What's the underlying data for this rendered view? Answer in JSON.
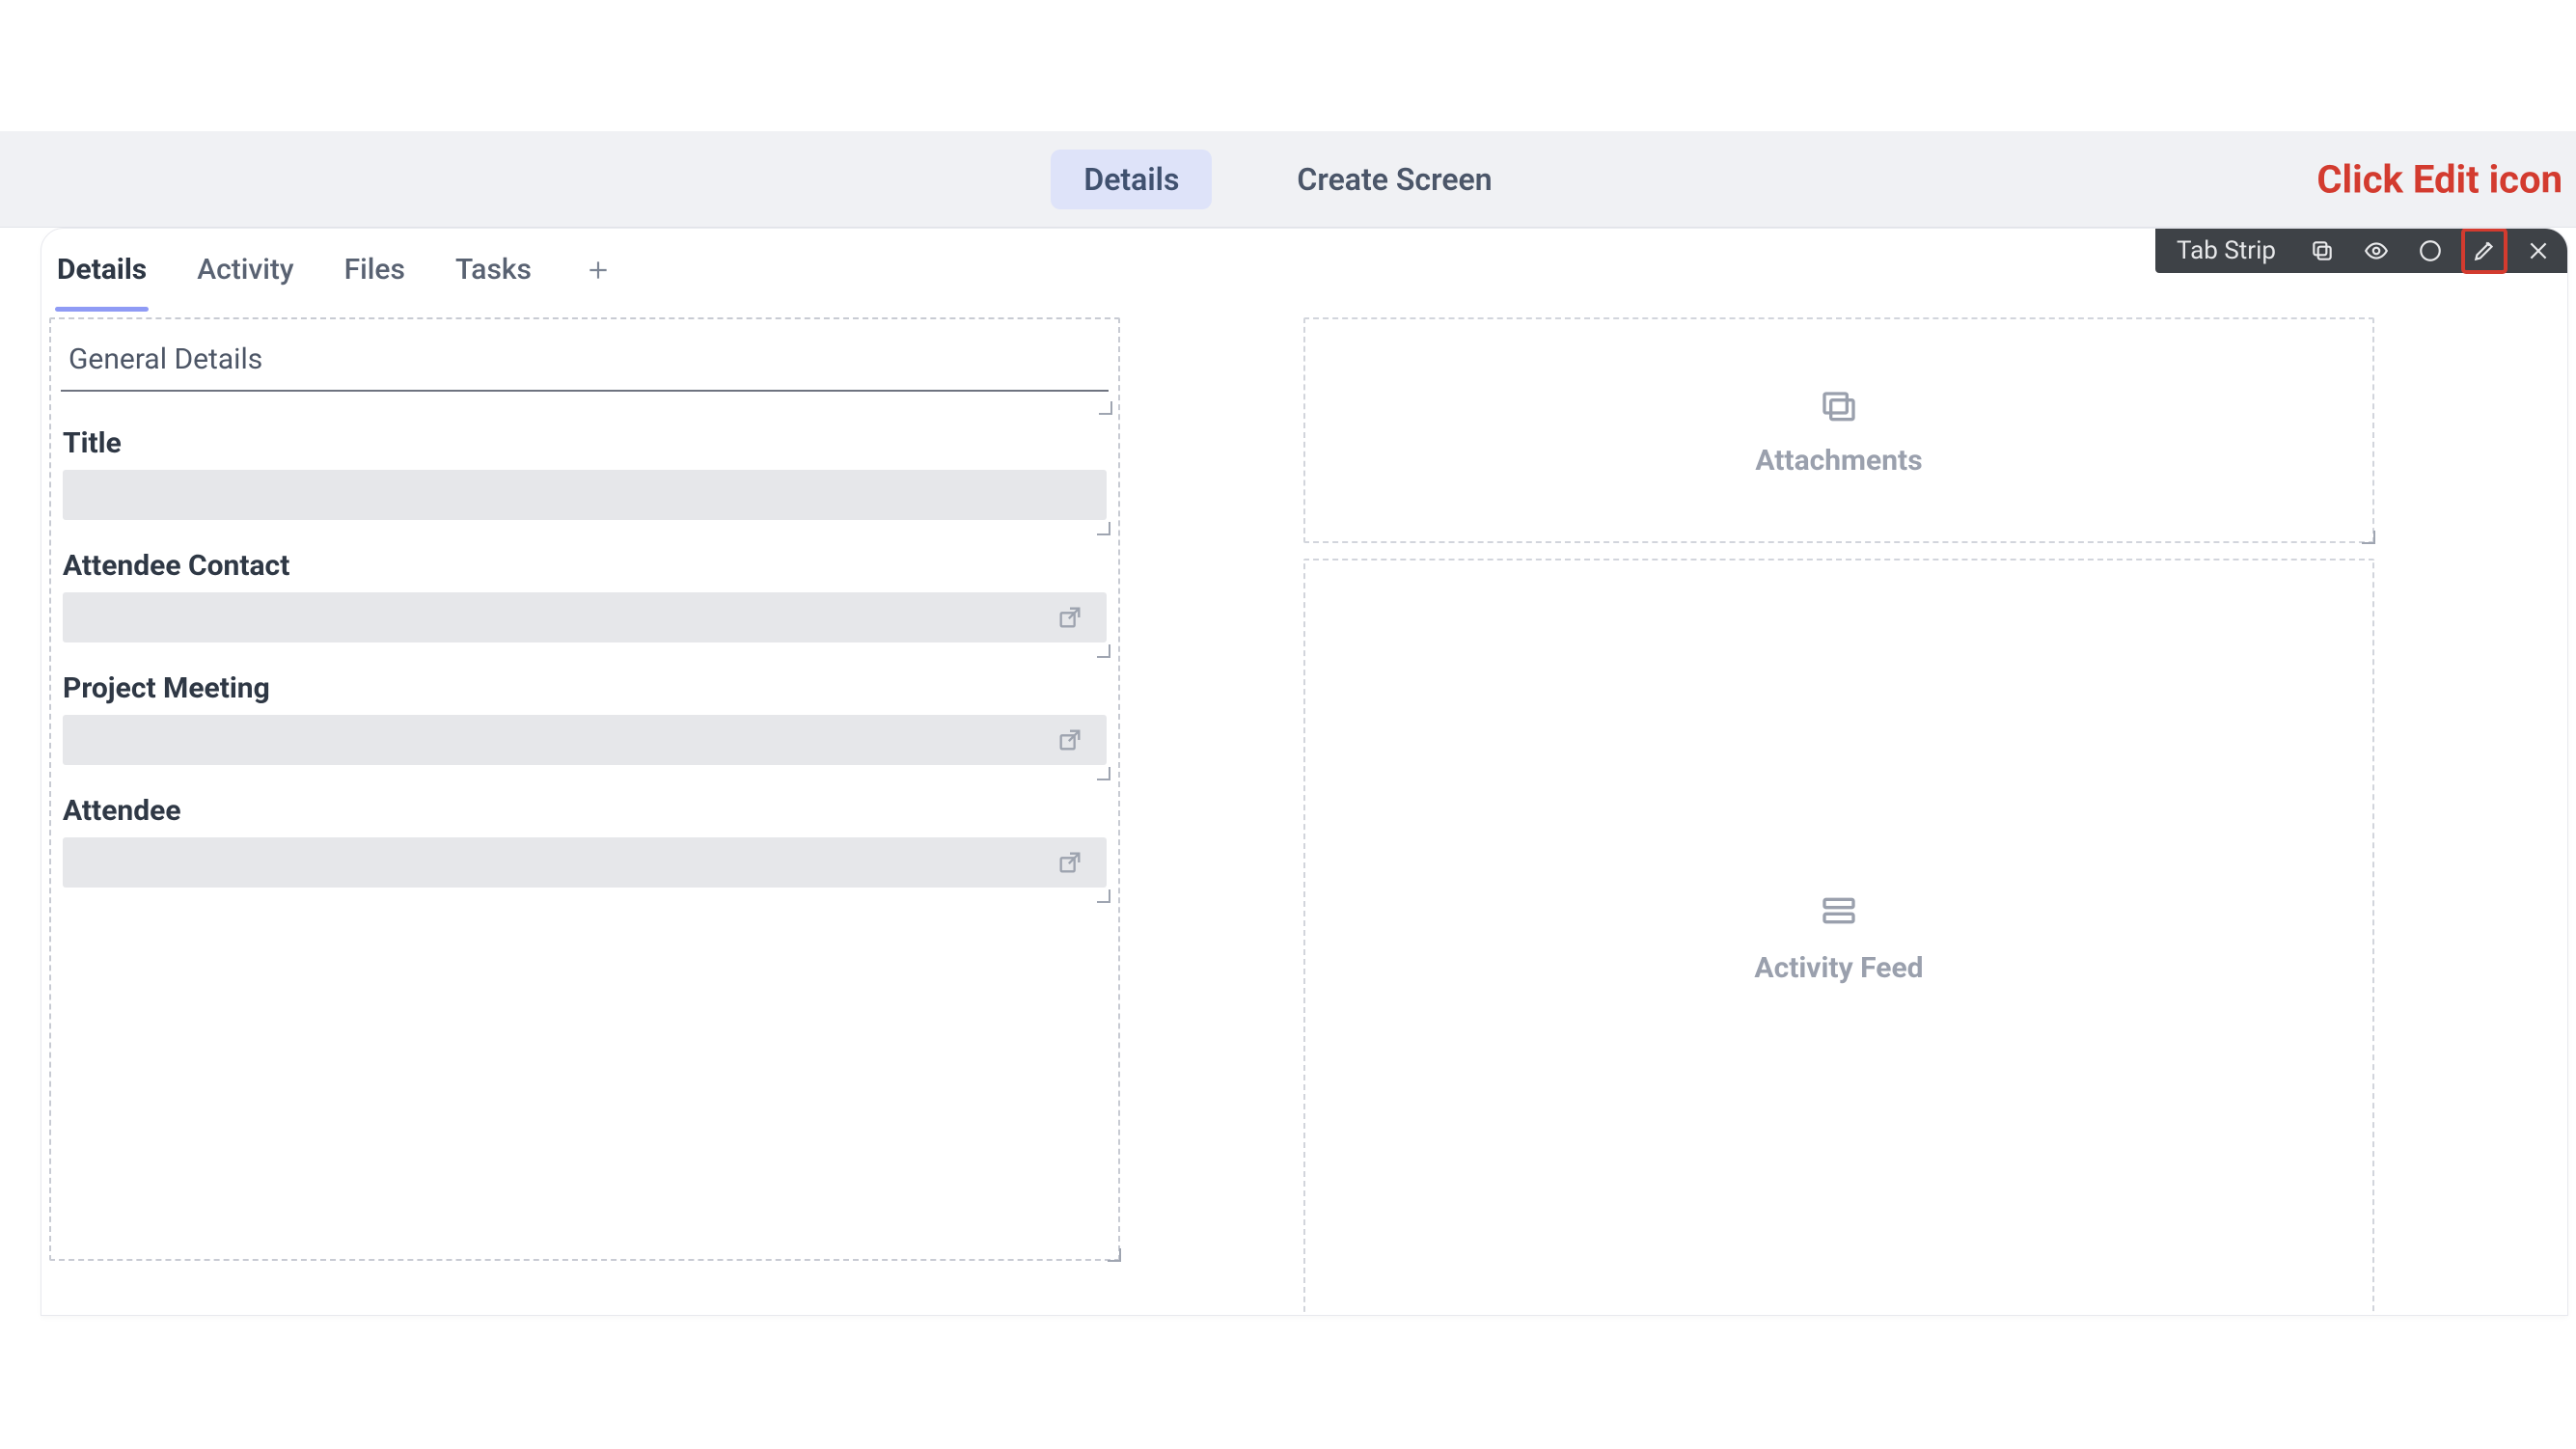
{
  "colors": {
    "callout": "#d33b2f",
    "accent": "#8f9bf5",
    "toolbar_bg": "#3e4247"
  },
  "top_tabs": {
    "details": "Details",
    "create_screen": "Create Screen"
  },
  "callout_text": "Click Edit icon",
  "element_toolbar": {
    "label": "Tab Strip",
    "icons": {
      "copy": "copy-icon",
      "visibility": "eye-icon",
      "radio": "circle-icon",
      "edit": "pencil-icon",
      "close": "close-icon"
    }
  },
  "secondary_tabs": [
    "Details",
    "Activity",
    "Files",
    "Tasks"
  ],
  "secondary_active_index": 0,
  "section_title": "General Details",
  "fields": [
    {
      "label": "Title",
      "type": "text"
    },
    {
      "label": "Attendee Contact",
      "type": "relation"
    },
    {
      "label": "Project Meeting",
      "type": "relation"
    },
    {
      "label": "Attendee",
      "type": "relation"
    }
  ],
  "right_placeholders": {
    "attachments": "Attachments",
    "activity_feed": "Activity Feed"
  }
}
